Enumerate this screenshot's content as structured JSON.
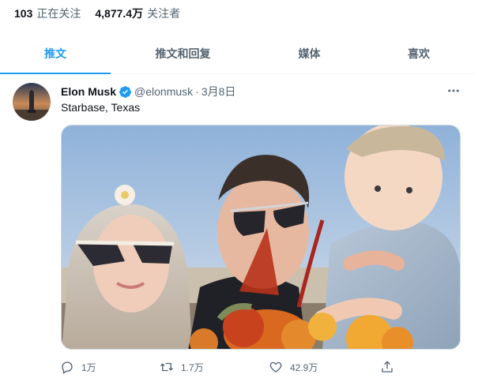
{
  "profile_stats": {
    "following_count": "103",
    "following_label": "正在关注",
    "followers_count": "4,877.4万",
    "followers_label": "关注者"
  },
  "tabs": [
    {
      "label": "推文",
      "active": true
    },
    {
      "label": "推文和回复",
      "active": false
    },
    {
      "label": "媒体",
      "active": false
    },
    {
      "label": "喜欢",
      "active": false
    }
  ],
  "tweet": {
    "author_name": "Elon Musk",
    "verified": true,
    "handle": "@elonmusk",
    "separator": "·",
    "date": "3月8日",
    "text": "Starbase, Texas",
    "actions": {
      "reply_count": "1万",
      "retweet_count": "1.7万",
      "like_count": "42.9万"
    }
  },
  "colors": {
    "accent": "#1d9bf0",
    "primary_text": "#0f1419",
    "secondary_text": "#536471",
    "border": "#eff3f4"
  },
  "icons": [
    "verified-badge-icon",
    "more-options-icon",
    "reply-icon",
    "retweet-icon",
    "like-icon",
    "share-icon"
  ]
}
